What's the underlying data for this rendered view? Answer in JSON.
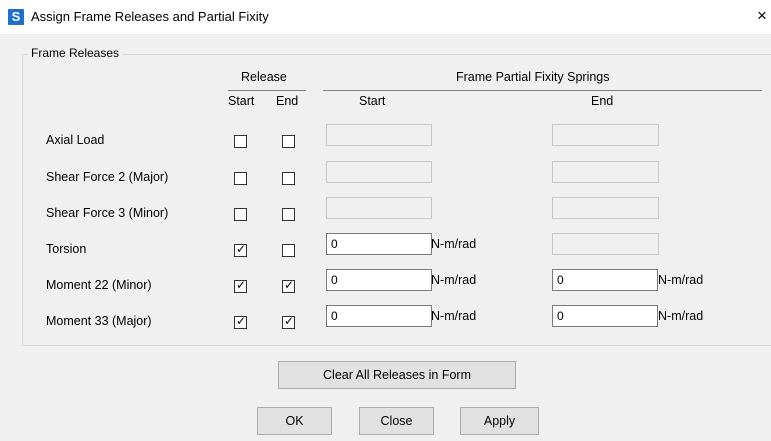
{
  "window": {
    "title": "Assign Frame Releases and Partial Fixity",
    "app_icon_letter": "S",
    "close_glyph": "×"
  },
  "group": {
    "title": "Frame Releases"
  },
  "headers": {
    "release": "Release",
    "release_start": "Start",
    "release_end": "End",
    "springs": "Frame Partial Fixity Springs",
    "springs_start": "Start",
    "springs_end": "End"
  },
  "rows": [
    {
      "label": "Axial Load",
      "start_checked": false,
      "end_checked": false,
      "start_value": "",
      "start_unit": "",
      "end_value": "",
      "end_unit": ""
    },
    {
      "label": "Shear Force 2 (Major)",
      "start_checked": false,
      "end_checked": false,
      "start_value": "",
      "start_unit": "",
      "end_value": "",
      "end_unit": ""
    },
    {
      "label": "Shear Force 3 (Minor)",
      "start_checked": false,
      "end_checked": false,
      "start_value": "",
      "start_unit": "",
      "end_value": "",
      "end_unit": ""
    },
    {
      "label": "Torsion",
      "start_checked": true,
      "end_checked": false,
      "start_value": "0",
      "start_unit": "N-m/rad",
      "end_value": "",
      "end_unit": ""
    },
    {
      "label": "Moment 22 (Minor)",
      "start_checked": true,
      "end_checked": true,
      "start_value": "0",
      "start_unit": "N-m/rad",
      "end_value": "0",
      "end_unit": "N-m/rad"
    },
    {
      "label": "Moment 33 (Major)",
      "start_checked": true,
      "end_checked": true,
      "start_value": "0",
      "start_unit": "N-m/rad",
      "end_value": "0",
      "end_unit": "N-m/rad"
    }
  ],
  "check_glyph": "✓",
  "buttons": {
    "clear": "Clear All Releases in Form",
    "ok": "OK",
    "close": "Close",
    "apply": "Apply"
  },
  "colors": {
    "app_icon": "#1e6fd0",
    "dialog_bg": "#f0f0f0",
    "titlebar_bg": "#ffffff"
  }
}
